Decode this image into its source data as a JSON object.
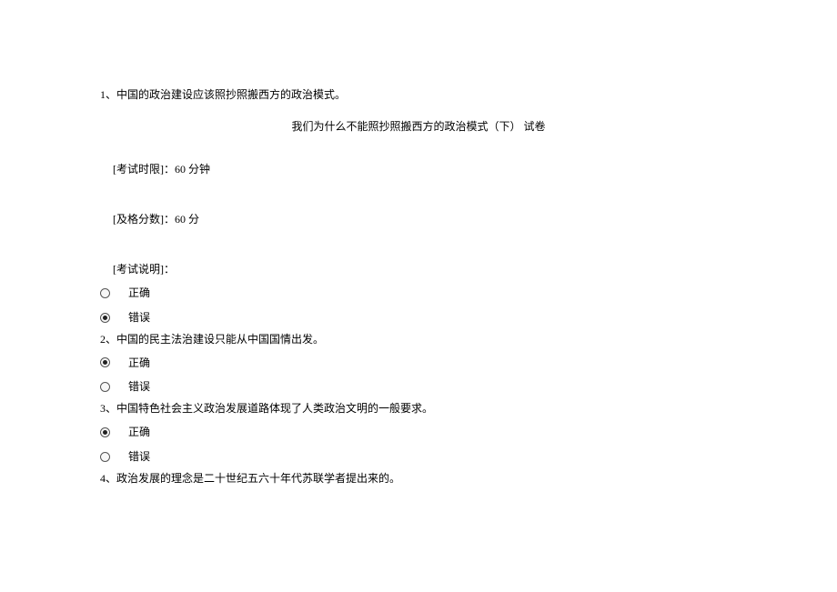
{
  "q1": {
    "number": "1、",
    "text": "中国的政治建设应该照抄照搬西方的政治模式。"
  },
  "title": "我们为什么不能照抄照搬西方的政治模式（下）   试卷",
  "meta": {
    "timeLimit": "[考试时限]：60 分钟",
    "passScore": "[及格分数]：60 分",
    "instructions": "[考试说明]："
  },
  "options": {
    "correct": "正确",
    "wrong": "错误"
  },
  "q2": {
    "number": "2、",
    "text": "中国的民主法治建设只能从中国国情出发。"
  },
  "q3": {
    "number": "3、",
    "text": "中国特色社会主义政治发展道路体现了人类政治文明的一般要求。"
  },
  "q4": {
    "number": "4、",
    "text": "政治发展的理念是二十世纪五六十年代苏联学者提出来的。"
  }
}
